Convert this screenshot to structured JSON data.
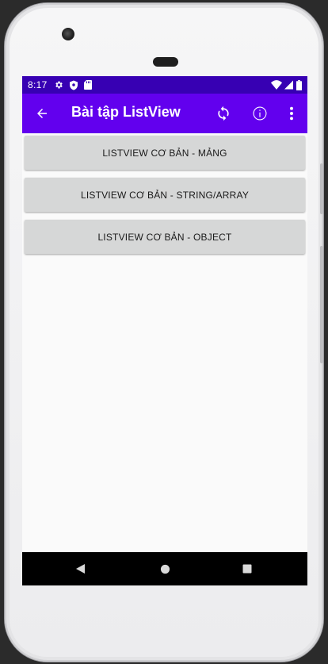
{
  "status_bar": {
    "time": "8:17",
    "left_icons": [
      "gear-icon",
      "shield-icon",
      "sd-card-icon"
    ],
    "right_icons": [
      "wifi-icon",
      "signal-icon",
      "battery-icon"
    ]
  },
  "app_bar": {
    "title": "Bài tập ListView",
    "icons": [
      "back-arrow-icon",
      "refresh-icon",
      "info-icon",
      "overflow-menu-icon"
    ]
  },
  "buttons": [
    {
      "label": "LISTVIEW CƠ BẢN - MẢNG"
    },
    {
      "label": "LISTVIEW CƠ BẢN - STRING/ARRAY"
    },
    {
      "label": "LISTVIEW CƠ BẢN - OBJECT"
    }
  ],
  "nav_bar": {
    "icons": [
      "back-triangle-icon",
      "home-circle-icon",
      "recents-square-icon"
    ]
  },
  "colors": {
    "status_bar": "#3700b3",
    "app_bar": "#6200ee",
    "button_bg": "#d6d7d7",
    "screen_bg": "#fafafa"
  }
}
